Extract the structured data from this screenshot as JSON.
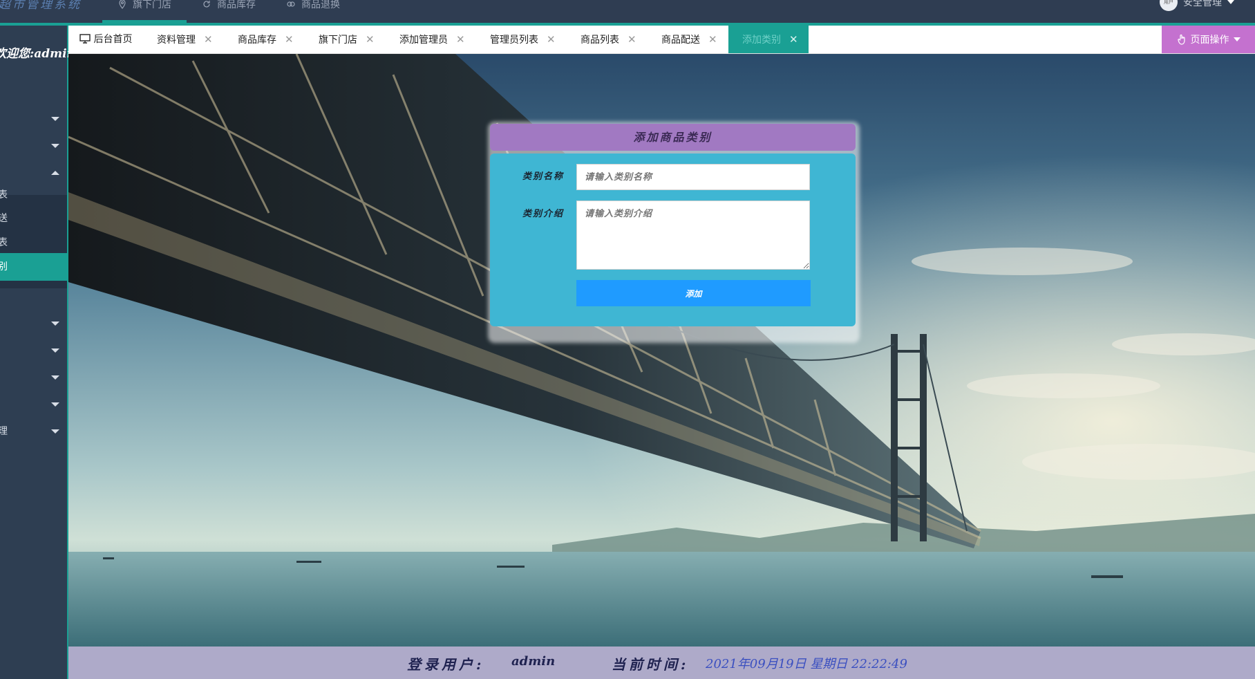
{
  "app": {
    "title": "超市管理系统"
  },
  "top_nav": [
    {
      "label": "旗下门店",
      "icon": "location-pin-icon",
      "active": true
    },
    {
      "label": "商品库存",
      "icon": "refresh-icon",
      "active": false
    },
    {
      "label": "商品退换",
      "icon": "exchange-icon",
      "active": false
    }
  ],
  "user": {
    "menu_label": "安全管理",
    "avatar_text": "用户"
  },
  "sidebar": {
    "welcome": "欢迎您:admin",
    "sub_items": [
      {
        "label": "管理员列表",
        "visible_text": "表"
      },
      {
        "label": "商品配送",
        "visible_text": "送"
      },
      {
        "label": "商品列表",
        "visible_text": "表"
      },
      {
        "label": "添加类别",
        "visible_text": "别",
        "active": true
      }
    ],
    "partial_label": "理"
  },
  "tabs": [
    {
      "label": "后台首页",
      "closable": false,
      "icon": "monitor-icon"
    },
    {
      "label": "资料管理",
      "closable": true
    },
    {
      "label": "商品库存",
      "closable": true
    },
    {
      "label": "旗下门店",
      "closable": true
    },
    {
      "label": "添加管理员",
      "closable": true
    },
    {
      "label": "管理员列表",
      "closable": true
    },
    {
      "label": "商品列表",
      "closable": true
    },
    {
      "label": "商品配送",
      "closable": true
    },
    {
      "label": "添加类别",
      "closable": true,
      "active": true
    }
  ],
  "page_ops": {
    "label": "页面操作",
    "icon": "hand-pointer-icon"
  },
  "form": {
    "title": "添加商品类别",
    "name_label": "类别名称",
    "name_placeholder": "请输入类别名称",
    "intro_label": "类别介绍",
    "intro_placeholder": "请输入类别介绍",
    "submit_label": "添加"
  },
  "footer": {
    "user_label": "登录用户:",
    "user_value": "admin",
    "time_label": "当前时间:",
    "time_value": "2021年09月19日 星期日 22:22:49"
  },
  "colors": {
    "topbar": "#2f3d52",
    "accent": "#1aa094",
    "panel_head": "#a179c2",
    "panel_body": "#3fb6d3",
    "submit": "#1f9bff",
    "page_ops": "#c471cf",
    "footer": "#aeaac9"
  }
}
